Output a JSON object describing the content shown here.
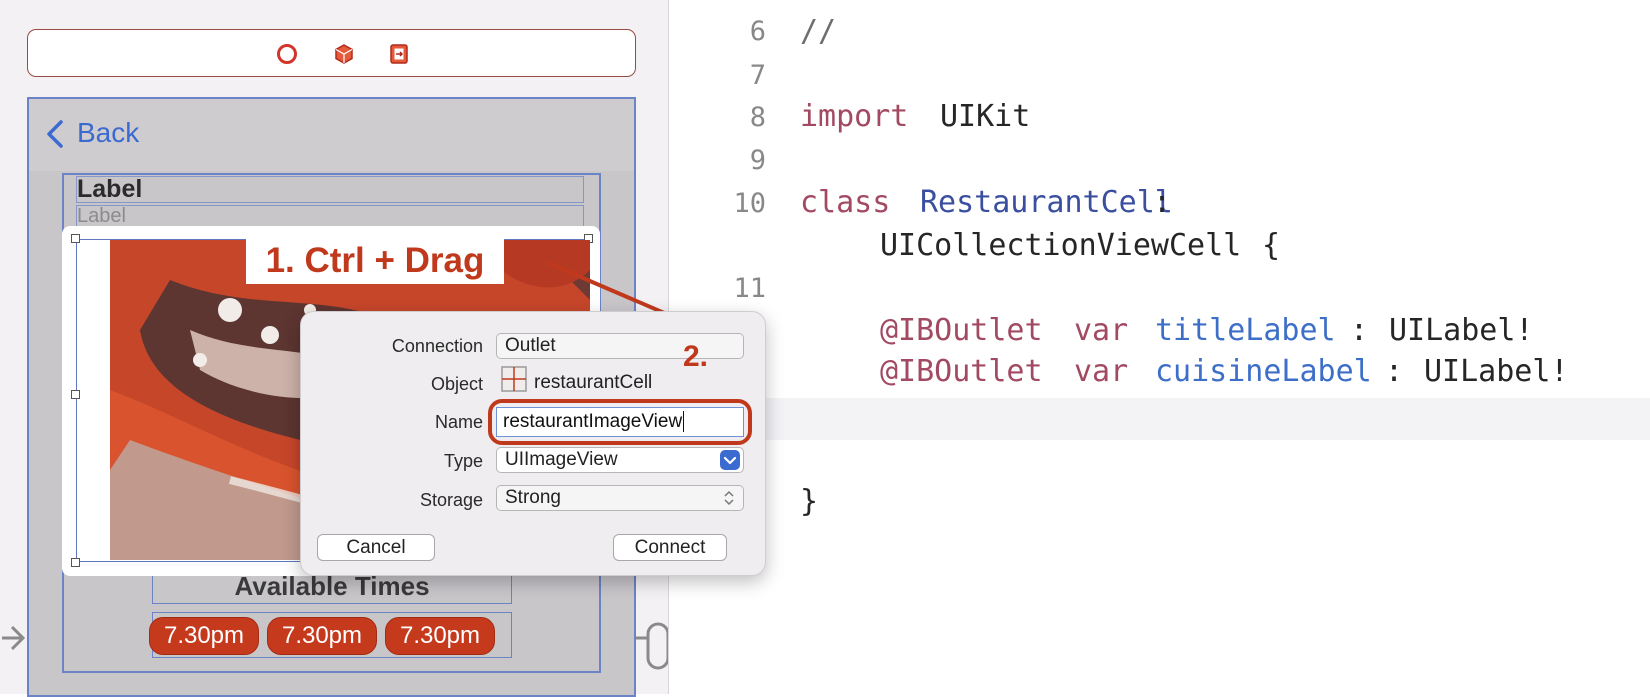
{
  "storyboard": {
    "nav_back_label": "Back",
    "title_label": "Label",
    "cuisine_label": "Label",
    "times_header": "Available Times",
    "time_slots": [
      "7.30pm",
      "7.30pm",
      "7.30pm"
    ]
  },
  "annotations": {
    "step1": "1. Ctrl + Drag",
    "step2": "2."
  },
  "dialog": {
    "connection_label": "Connection",
    "connection_value": "Outlet",
    "object_label": "Object",
    "object_value": "restaurantCell",
    "name_label": "Name",
    "name_value": "restaurantImageView",
    "type_label": "Type",
    "type_value": "UIImageView",
    "storage_label": "Storage",
    "storage_value": "Strong",
    "cancel_label": "Cancel",
    "connect_label": "Connect"
  },
  "code": {
    "line_numbers": [
      "6",
      "7",
      "8",
      "9",
      "10",
      "11"
    ],
    "comment": "//",
    "import_kw": "import",
    "import_module": "UIKit",
    "class_kw": "class",
    "class_name": "RestaurantCell",
    "superclass": "UICollectionViewCell",
    "brace_open": "{",
    "brace_close": "}",
    "outlet_attr": "@IBOutlet",
    "var_kw": "var",
    "outlet1_name": "titleLabel",
    "outlet2_name": "cuisineLabel",
    "outlet_type": "UILabel!"
  },
  "colors": {
    "accent_red": "#c0391c",
    "selection_blue": "#6b84c7",
    "keyword": "#a34a63",
    "type": "#3b4fa0",
    "property": "#3e6fc8"
  },
  "icons": [
    "view-controller-icon",
    "first-responder-icon",
    "exit-icon",
    "back-chevron-icon",
    "object-cell-icon",
    "popup-chevron-icon"
  ]
}
